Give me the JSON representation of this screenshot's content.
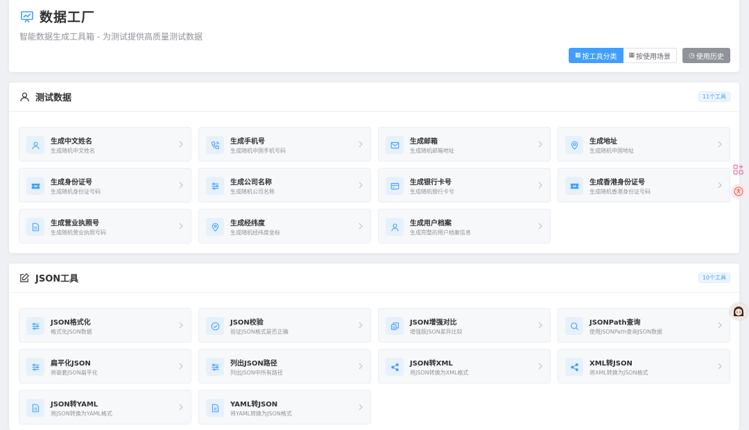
{
  "header": {
    "title": "数据工厂",
    "subtitle": "智能数据生成工具箱 - 为测试提供高质量测试数据",
    "view_by_category": "按工具分类",
    "view_by_scene": "按使用场景",
    "history": "使用历史",
    "accent_color": "#409eff"
  },
  "sections": [
    {
      "title": "测试数据",
      "count": "11个工具",
      "icon": "user-icon",
      "tools": [
        {
          "name": "生成中文姓名",
          "desc": "生成随机中文姓名",
          "icon": "user-icon"
        },
        {
          "name": "生成手机号",
          "desc": "生成随机中国手机号码",
          "icon": "phone-icon"
        },
        {
          "name": "生成邮箱",
          "desc": "生成随机邮箱地址",
          "icon": "mail-icon"
        },
        {
          "name": "生成地址",
          "desc": "生成随机中国地址",
          "icon": "location-icon"
        },
        {
          "name": "生成身份证号",
          "desc": "生成随机身份证号码",
          "icon": "ticket-icon"
        },
        {
          "name": "生成公司名称",
          "desc": "生成随机公司名称",
          "icon": "sliders-icon"
        },
        {
          "name": "生成银行卡号",
          "desc": "生成随机银行卡号",
          "icon": "card-icon"
        },
        {
          "name": "生成香港身份证号",
          "desc": "生成随机香港身份证号码",
          "icon": "ticket-icon"
        },
        {
          "name": "生成营业执照号",
          "desc": "生成随机营业执照号码",
          "icon": "document-icon"
        },
        {
          "name": "生成经纬度",
          "desc": "生成随机经纬度坐标",
          "icon": "location-icon"
        },
        {
          "name": "生成用户档案",
          "desc": "生成完整的用户档案信息",
          "icon": "user-icon"
        }
      ]
    },
    {
      "title": "JSON工具",
      "count": "10个工具",
      "icon": "edit-icon",
      "tools": [
        {
          "name": "JSON格式化",
          "desc": "格式化JSON数据",
          "icon": "sliders-icon"
        },
        {
          "name": "JSON校验",
          "desc": "验证JSON格式是否正确",
          "icon": "check-circle-icon"
        },
        {
          "name": "JSON增强对比",
          "desc": "增强版JSON差异比较",
          "icon": "copy-icon"
        },
        {
          "name": "JSONPath查询",
          "desc": "使用JSONPath查询JSON数据",
          "icon": "search-icon"
        },
        {
          "name": "扁平化JSON",
          "desc": "将嵌套JSON扁平化",
          "icon": "sliders-icon"
        },
        {
          "name": "列出JSON路径",
          "desc": "列出JSON中所有路径",
          "icon": "sliders-icon"
        },
        {
          "name": "JSON转XML",
          "desc": "将JSON转换为XML格式",
          "icon": "share-icon"
        },
        {
          "name": "XML转JSON",
          "desc": "将XML转换为JSON格式",
          "icon": "share-icon"
        },
        {
          "name": "JSON转YAML",
          "desc": "将JSON转换为YAML格式",
          "icon": "document-icon"
        },
        {
          "name": "YAML转JSON",
          "desc": "将YAML转换为JSON格式",
          "icon": "document-icon"
        }
      ]
    }
  ]
}
